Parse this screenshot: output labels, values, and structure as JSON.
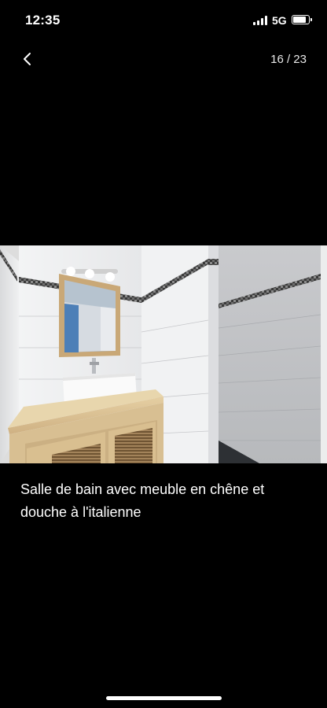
{
  "status_bar": {
    "time": "12:35",
    "network": "5G",
    "signal_bars": 4,
    "battery_level": 0.9
  },
  "gallery": {
    "current": 16,
    "total": 23,
    "counter_text": "16 / 23",
    "back_icon": "chevron-left-icon"
  },
  "photo": {
    "caption": "Salle de bain avec meuble en chêne  et\ndouche à l'italienne"
  },
  "colors": {
    "background": "#000000",
    "text": "#ffffff"
  }
}
